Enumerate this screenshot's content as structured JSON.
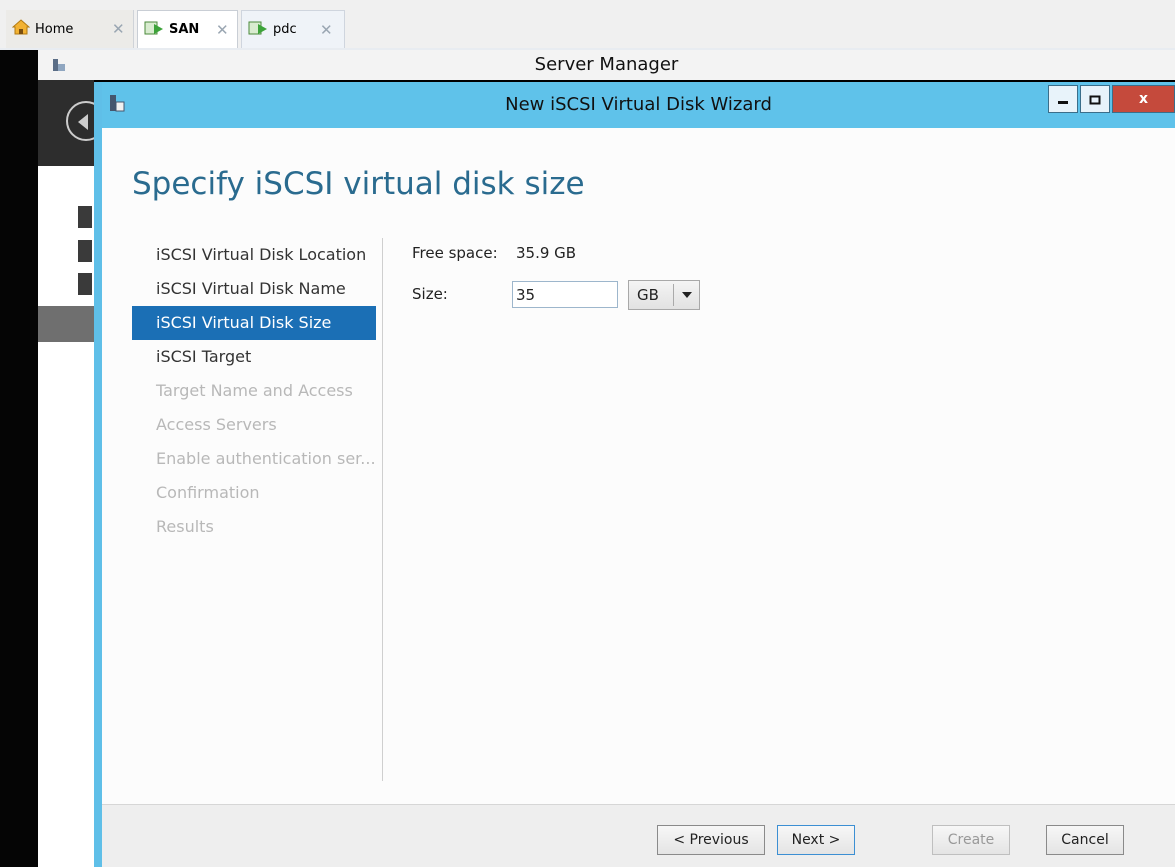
{
  "vm_tabs": [
    {
      "label": "Home"
    },
    {
      "label": "SAN"
    },
    {
      "label": "pdc"
    }
  ],
  "server_manager": {
    "title": "Server Manager"
  },
  "wizard": {
    "title": "New iSCSI Virtual Disk Wizard",
    "heading": "Specify iSCSI virtual disk size",
    "close_glyph": "x",
    "steps": [
      {
        "label": "iSCSI Virtual Disk Location",
        "state": "done"
      },
      {
        "label": "iSCSI Virtual Disk Name",
        "state": "done"
      },
      {
        "label": "iSCSI Virtual Disk Size",
        "state": "active"
      },
      {
        "label": "iSCSI Target",
        "state": "enabled"
      },
      {
        "label": "Target Name and Access",
        "state": "disabled"
      },
      {
        "label": "Access Servers",
        "state": "disabled"
      },
      {
        "label": "Enable authentication ser...",
        "state": "disabled"
      },
      {
        "label": "Confirmation",
        "state": "disabled"
      },
      {
        "label": "Results",
        "state": "disabled"
      }
    ],
    "free_space_label": "Free space:",
    "free_space_value": "35.9 GB",
    "size_label": "Size:",
    "size_value": "35",
    "unit_selected": "GB",
    "buttons": {
      "previous": "< Previous",
      "next": "Next >",
      "create": "Create",
      "cancel": "Cancel"
    }
  },
  "colors": {
    "titlebar": "#5fc2ea",
    "active_step": "#1b6fb5",
    "heading": "#2a6b8f"
  }
}
